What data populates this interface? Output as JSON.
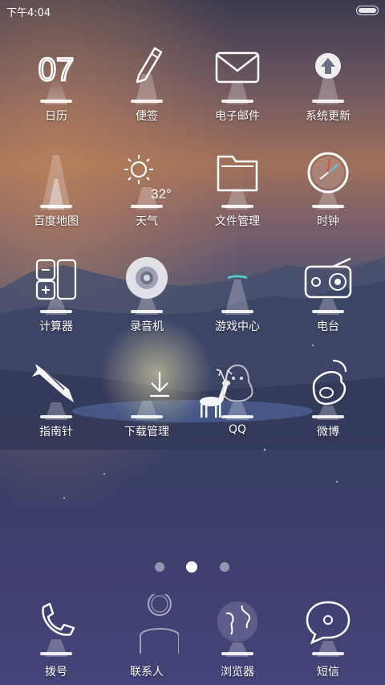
{
  "status_bar": {
    "time": "下午4:04"
  },
  "apps": [
    {
      "label": "日历",
      "icon": "calendar-icon",
      "date": "07"
    },
    {
      "label": "便签",
      "icon": "pencil-icon"
    },
    {
      "label": "电子邮件",
      "icon": "envelope-icon"
    },
    {
      "label": "系统更新",
      "icon": "update-arrow-icon"
    },
    {
      "label": "百度地图",
      "icon": "map-beam-icon"
    },
    {
      "label": "天气",
      "icon": "sun-icon",
      "temperature": "32°"
    },
    {
      "label": "文件管理",
      "icon": "folder-icon"
    },
    {
      "label": "时钟",
      "icon": "clock-icon"
    },
    {
      "label": "计算器",
      "icon": "calculator-icon"
    },
    {
      "label": "录音机",
      "icon": "recorder-icon"
    },
    {
      "label": "游戏中心",
      "icon": "game-center-icon"
    },
    {
      "label": "电台",
      "icon": "radio-icon"
    },
    {
      "label": "指南针",
      "icon": "compass-icon"
    },
    {
      "label": "下载管理",
      "icon": "download-arrow-icon"
    },
    {
      "label": "QQ",
      "icon": "qq-penguin-icon"
    },
    {
      "label": "微博",
      "icon": "weibo-icon"
    }
  ],
  "page_indicator": {
    "pages": 3,
    "current": 2
  },
  "dock": [
    {
      "label": "拨号",
      "icon": "phone-icon"
    },
    {
      "label": "联系人",
      "icon": "contact-person-icon"
    },
    {
      "label": "浏览器",
      "icon": "globe-icon"
    },
    {
      "label": "短信",
      "icon": "message-bubble-icon"
    }
  ],
  "colors": {
    "moon": "#f5c842",
    "glow": "#ffffff",
    "text": "#ffffff"
  }
}
